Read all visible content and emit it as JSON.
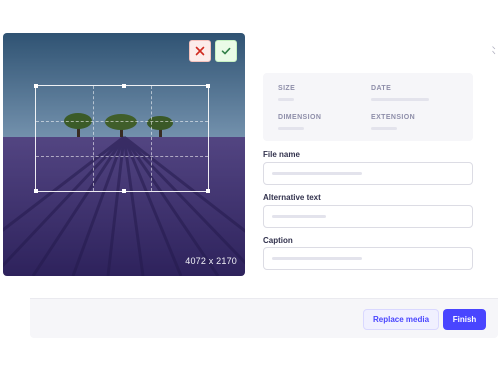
{
  "preview": {
    "dimensions": "4072 x 2170"
  },
  "crop_actions": {
    "cancel_icon": "close-icon",
    "confirm_icon": "check-icon"
  },
  "info": {
    "size_label": "SIZE",
    "date_label": "DATE",
    "dimension_label": "DIMENSION",
    "extension_label": "EXTENSION"
  },
  "form": {
    "file_name_label": "File name",
    "alt_text_label": "Alternative text",
    "caption_label": "Caption"
  },
  "footer": {
    "replace_label": "Replace media",
    "finish_label": "Finish"
  },
  "colors": {
    "primary": "#4945ff",
    "danger": "#d02b20",
    "success": "#328048"
  }
}
